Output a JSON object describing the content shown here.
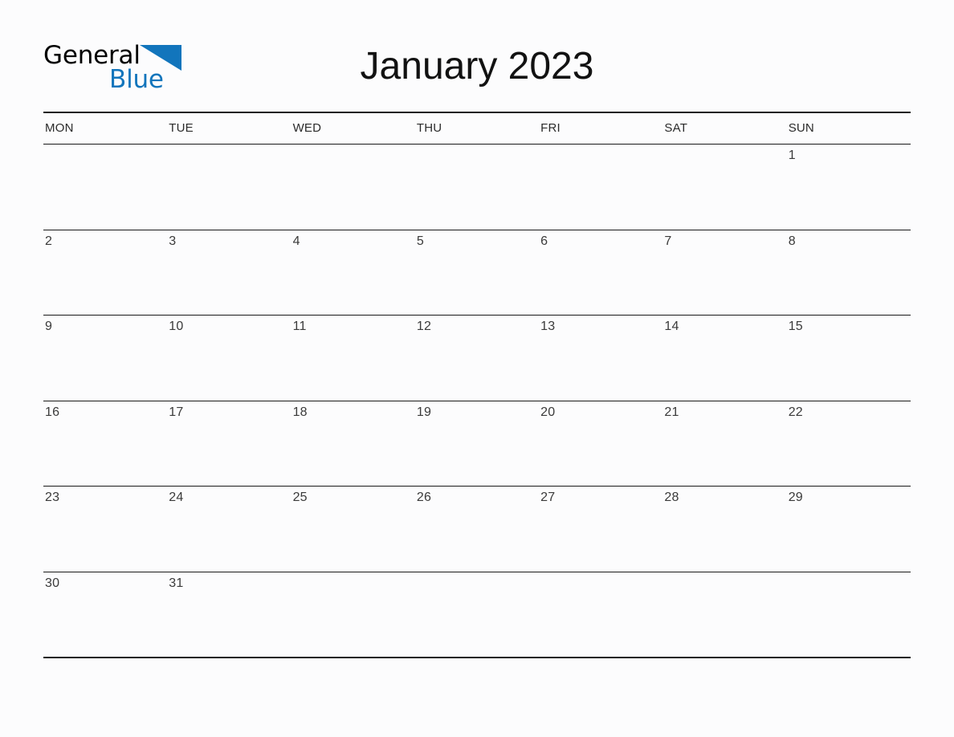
{
  "logo": {
    "text_primary": "General",
    "text_secondary": "Blue",
    "primary_color": "#000000",
    "secondary_color": "#1275bc",
    "triangle_color": "#1275bc"
  },
  "header": {
    "title": "January 2023"
  },
  "calendar": {
    "month": "January",
    "year": "2023",
    "week_start": "MON",
    "weekdays": [
      "MON",
      "TUE",
      "WED",
      "THU",
      "FRI",
      "SAT",
      "SUN"
    ],
    "weeks": [
      [
        "",
        "",
        "",
        "",
        "",
        "",
        "1"
      ],
      [
        "2",
        "3",
        "4",
        "5",
        "6",
        "7",
        "8"
      ],
      [
        "9",
        "10",
        "11",
        "12",
        "13",
        "14",
        "15"
      ],
      [
        "16",
        "17",
        "18",
        "19",
        "20",
        "21",
        "22"
      ],
      [
        "23",
        "24",
        "25",
        "26",
        "27",
        "28",
        "29"
      ],
      [
        "30",
        "31",
        "",
        "",
        "",
        "",
        ""
      ]
    ]
  },
  "style": {
    "background": "#fcfcfd",
    "rule_color": "#1a1a1a",
    "date_text_color": "#3a3a3a",
    "weekday_text_color": "#2b2b2b",
    "title_color": "#121212"
  }
}
